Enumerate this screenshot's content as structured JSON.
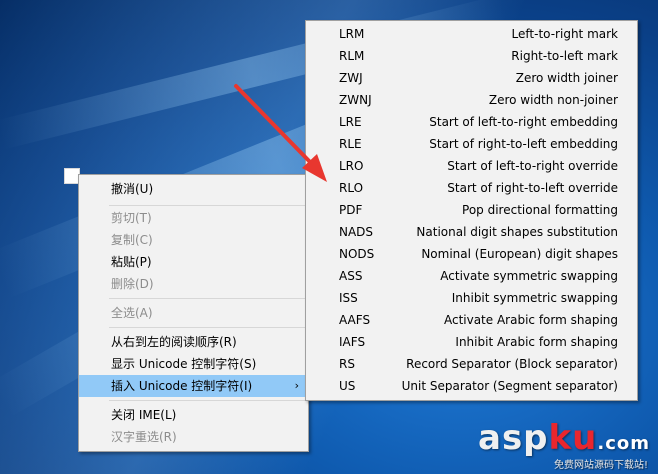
{
  "context_menu": {
    "items": [
      {
        "label": "撤消(U)",
        "enabled": true
      },
      {
        "label": "剪切(T)",
        "enabled": false
      },
      {
        "label": "复制(C)",
        "enabled": false
      },
      {
        "label": "粘贴(P)",
        "enabled": true
      },
      {
        "label": "删除(D)",
        "enabled": false
      },
      {
        "label": "全选(A)",
        "enabled": false
      },
      {
        "label": "从右到左的阅读顺序(R)",
        "enabled": true
      },
      {
        "label": "显示 Unicode 控制字符(S)",
        "enabled": true
      },
      {
        "label": "插入 Unicode 控制字符(I)",
        "enabled": true,
        "highlighted": true,
        "has_submenu": true
      },
      {
        "label": "关闭 IME(L)",
        "enabled": true
      },
      {
        "label": "汉字重选(R)",
        "enabled": false
      }
    ],
    "submenu_chevron": "›"
  },
  "submenu": {
    "items": [
      {
        "code": "LRM",
        "desc": "Left-to-right mark"
      },
      {
        "code": "RLM",
        "desc": "Right-to-left mark"
      },
      {
        "code": "ZWJ",
        "desc": "Zero width joiner"
      },
      {
        "code": "ZWNJ",
        "desc": "Zero width non-joiner"
      },
      {
        "code": "LRE",
        "desc": "Start of left-to-right embedding"
      },
      {
        "code": "RLE",
        "desc": "Start of right-to-left embedding"
      },
      {
        "code": "LRO",
        "desc": "Start of left-to-right override"
      },
      {
        "code": "RLO",
        "desc": "Start of right-to-left override"
      },
      {
        "code": "PDF",
        "desc": "Pop directional formatting"
      },
      {
        "code": "NADS",
        "desc": "National digit shapes substitution"
      },
      {
        "code": "NODS",
        "desc": "Nominal (European) digit shapes"
      },
      {
        "code": "ASS",
        "desc": "Activate symmetric swapping"
      },
      {
        "code": "ISS",
        "desc": "Inhibit symmetric swapping"
      },
      {
        "code": "AAFS",
        "desc": "Activate Arabic form shaping"
      },
      {
        "code": "IAFS",
        "desc": "Inhibit Arabic form shaping"
      },
      {
        "code": "RS",
        "desc": "Record Separator (Block separator)"
      },
      {
        "code": "US",
        "desc": "Unit Separator (Segment separator)"
      }
    ]
  },
  "watermark": {
    "logo_a": "asp",
    "logo_b": "ku",
    "logo_c": ".com",
    "tagline": "免费网站源码下载站!"
  },
  "colors": {
    "highlight": "#91c9f7",
    "arrow": "#e8372f",
    "watermark_red": "#e8262d"
  },
  "icons": {
    "pointer_arrow": "red-arrow-icon"
  }
}
